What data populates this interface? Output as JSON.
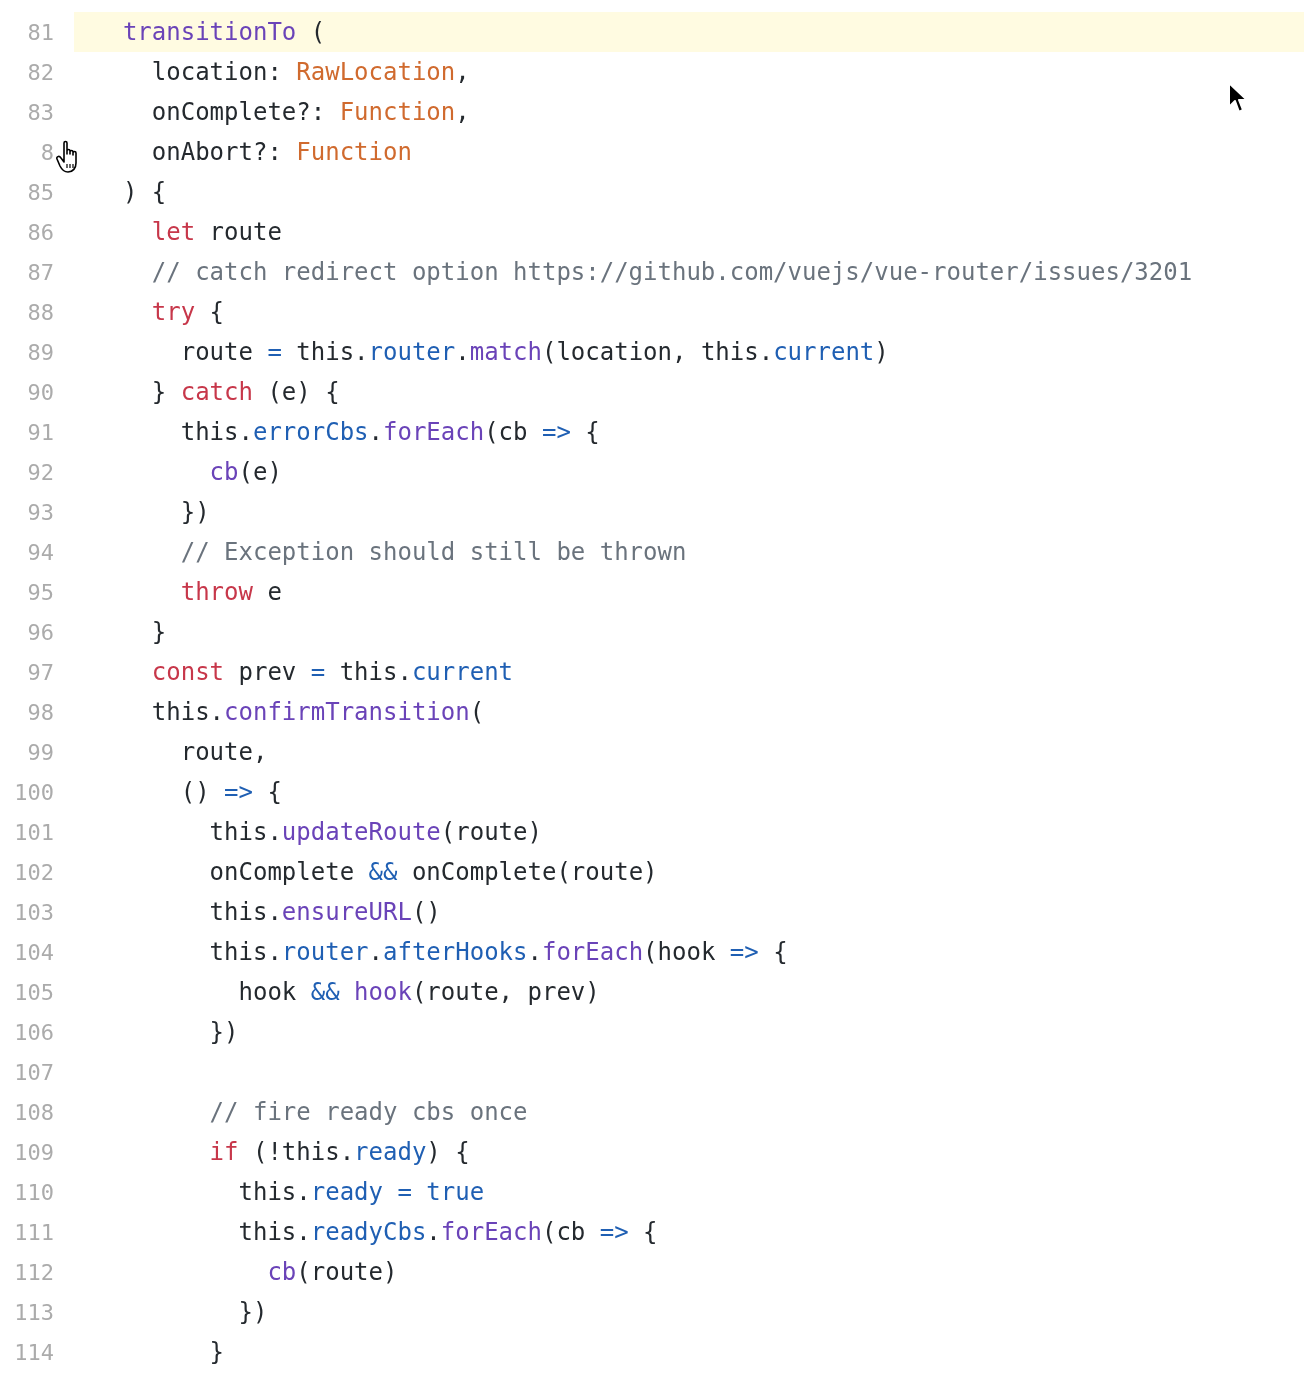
{
  "code_lines": [
    {
      "number": "81",
      "highlighted": true,
      "tokens": [
        {
          "kind": "func",
          "text": "  transitionTo"
        },
        {
          "kind": "plain",
          "text": " ("
        }
      ]
    },
    {
      "number": "82",
      "highlighted": false,
      "tokens": [
        {
          "kind": "plain",
          "text": "    location: "
        },
        {
          "kind": "type",
          "text": "RawLocation"
        },
        {
          "kind": "plain",
          "text": ","
        }
      ]
    },
    {
      "number": "83",
      "highlighted": false,
      "tokens": [
        {
          "kind": "plain",
          "text": "    onComplete?: "
        },
        {
          "kind": "type",
          "text": "Function"
        },
        {
          "kind": "plain",
          "text": ","
        }
      ]
    },
    {
      "number": "8",
      "highlighted": false,
      "tokens": [
        {
          "kind": "plain",
          "text": "    onAbort?: "
        },
        {
          "kind": "type",
          "text": "Function"
        }
      ]
    },
    {
      "number": "85",
      "highlighted": false,
      "tokens": [
        {
          "kind": "plain",
          "text": "  ) {"
        }
      ]
    },
    {
      "number": "86",
      "highlighted": false,
      "tokens": [
        {
          "kind": "keyword",
          "text": "    let"
        },
        {
          "kind": "plain",
          "text": " route"
        }
      ]
    },
    {
      "number": "87",
      "highlighted": false,
      "tokens": [
        {
          "kind": "comment",
          "text": "    // catch redirect option https://github.com/vuejs/vue-router/issues/3201"
        }
      ]
    },
    {
      "number": "88",
      "highlighted": false,
      "tokens": [
        {
          "kind": "keyword",
          "text": "    try"
        },
        {
          "kind": "plain",
          "text": " {"
        }
      ]
    },
    {
      "number": "89",
      "highlighted": false,
      "tokens": [
        {
          "kind": "plain",
          "text": "      route "
        },
        {
          "kind": "operator",
          "text": "="
        },
        {
          "kind": "plain",
          "text": " this."
        },
        {
          "kind": "property",
          "text": "router"
        },
        {
          "kind": "plain",
          "text": "."
        },
        {
          "kind": "func",
          "text": "match"
        },
        {
          "kind": "plain",
          "text": "(location, this."
        },
        {
          "kind": "property",
          "text": "current"
        },
        {
          "kind": "plain",
          "text": ")"
        }
      ]
    },
    {
      "number": "90",
      "highlighted": false,
      "tokens": [
        {
          "kind": "plain",
          "text": "    } "
        },
        {
          "kind": "keyword",
          "text": "catch"
        },
        {
          "kind": "plain",
          "text": " (e) {"
        }
      ]
    },
    {
      "number": "91",
      "highlighted": false,
      "tokens": [
        {
          "kind": "plain",
          "text": "      this."
        },
        {
          "kind": "property",
          "text": "errorCbs"
        },
        {
          "kind": "plain",
          "text": "."
        },
        {
          "kind": "func",
          "text": "forEach"
        },
        {
          "kind": "plain",
          "text": "(cb "
        },
        {
          "kind": "operator",
          "text": "=>"
        },
        {
          "kind": "plain",
          "text": " {"
        }
      ]
    },
    {
      "number": "92",
      "highlighted": false,
      "tokens": [
        {
          "kind": "func",
          "text": "        cb"
        },
        {
          "kind": "plain",
          "text": "(e)"
        }
      ]
    },
    {
      "number": "93",
      "highlighted": false,
      "tokens": [
        {
          "kind": "plain",
          "text": "      })"
        }
      ]
    },
    {
      "number": "94",
      "highlighted": false,
      "tokens": [
        {
          "kind": "comment",
          "text": "      // Exception should still be thrown"
        }
      ]
    },
    {
      "number": "95",
      "highlighted": false,
      "tokens": [
        {
          "kind": "keyword",
          "text": "      throw"
        },
        {
          "kind": "plain",
          "text": " e"
        }
      ]
    },
    {
      "number": "96",
      "highlighted": false,
      "tokens": [
        {
          "kind": "plain",
          "text": "    }"
        }
      ]
    },
    {
      "number": "97",
      "highlighted": false,
      "tokens": [
        {
          "kind": "keyword",
          "text": "    const"
        },
        {
          "kind": "plain",
          "text": " prev "
        },
        {
          "kind": "operator",
          "text": "="
        },
        {
          "kind": "plain",
          "text": " this."
        },
        {
          "kind": "property",
          "text": "current"
        }
      ]
    },
    {
      "number": "98",
      "highlighted": false,
      "tokens": [
        {
          "kind": "plain",
          "text": "    this."
        },
        {
          "kind": "func",
          "text": "confirmTransition"
        },
        {
          "kind": "plain",
          "text": "("
        }
      ]
    },
    {
      "number": "99",
      "highlighted": false,
      "tokens": [
        {
          "kind": "plain",
          "text": "      route,"
        }
      ]
    },
    {
      "number": "100",
      "highlighted": false,
      "tokens": [
        {
          "kind": "plain",
          "text": "      () "
        },
        {
          "kind": "operator",
          "text": "=>"
        },
        {
          "kind": "plain",
          "text": " {"
        }
      ]
    },
    {
      "number": "101",
      "highlighted": false,
      "tokens": [
        {
          "kind": "plain",
          "text": "        this."
        },
        {
          "kind": "func",
          "text": "updateRoute"
        },
        {
          "kind": "plain",
          "text": "(route)"
        }
      ]
    },
    {
      "number": "102",
      "highlighted": false,
      "tokens": [
        {
          "kind": "plain",
          "text": "        onComplete "
        },
        {
          "kind": "operator",
          "text": "&&"
        },
        {
          "kind": "plain",
          "text": " onComplete(route)"
        }
      ]
    },
    {
      "number": "103",
      "highlighted": false,
      "tokens": [
        {
          "kind": "plain",
          "text": "        this."
        },
        {
          "kind": "func",
          "text": "ensureURL"
        },
        {
          "kind": "plain",
          "text": "()"
        }
      ]
    },
    {
      "number": "104",
      "highlighted": false,
      "tokens": [
        {
          "kind": "plain",
          "text": "        this."
        },
        {
          "kind": "property",
          "text": "router"
        },
        {
          "kind": "plain",
          "text": "."
        },
        {
          "kind": "property",
          "text": "afterHooks"
        },
        {
          "kind": "plain",
          "text": "."
        },
        {
          "kind": "func",
          "text": "forEach"
        },
        {
          "kind": "plain",
          "text": "(hook "
        },
        {
          "kind": "operator",
          "text": "=>"
        },
        {
          "kind": "plain",
          "text": " {"
        }
      ]
    },
    {
      "number": "105",
      "highlighted": false,
      "tokens": [
        {
          "kind": "plain",
          "text": "          hook "
        },
        {
          "kind": "operator",
          "text": "&&"
        },
        {
          "kind": "func",
          "text": " hook"
        },
        {
          "kind": "plain",
          "text": "(route, prev)"
        }
      ]
    },
    {
      "number": "106",
      "highlighted": false,
      "tokens": [
        {
          "kind": "plain",
          "text": "        })"
        }
      ]
    },
    {
      "number": "107",
      "highlighted": false
    },
    {
      "number": "108",
      "highlighted": false,
      "tokens": [
        {
          "kind": "comment",
          "text": "        // fire ready cbs once"
        }
      ]
    },
    {
      "number": "109",
      "highlighted": false,
      "tokens": [
        {
          "kind": "keyword",
          "text": "        if"
        },
        {
          "kind": "plain",
          "text": " (!this."
        },
        {
          "kind": "property",
          "text": "ready"
        },
        {
          "kind": "plain",
          "text": ") {"
        }
      ]
    },
    {
      "number": "110",
      "highlighted": false,
      "tokens": [
        {
          "kind": "plain",
          "text": "          this."
        },
        {
          "kind": "property",
          "text": "ready"
        },
        {
          "kind": "operator",
          "text": " = true"
        }
      ]
    },
    {
      "number": "111",
      "highlighted": false,
      "tokens": [
        {
          "kind": "plain",
          "text": "          this."
        },
        {
          "kind": "property",
          "text": "readyCbs"
        },
        {
          "kind": "plain",
          "text": "."
        },
        {
          "kind": "func",
          "text": "forEach"
        },
        {
          "kind": "plain",
          "text": "(cb "
        },
        {
          "kind": "operator",
          "text": "=>"
        },
        {
          "kind": "plain",
          "text": " {"
        }
      ]
    },
    {
      "number": "112",
      "highlighted": false,
      "tokens": [
        {
          "kind": "func",
          "text": "            cb"
        },
        {
          "kind": "plain",
          "text": "(route)"
        }
      ]
    },
    {
      "number": "113",
      "highlighted": false,
      "tokens": [
        {
          "kind": "plain",
          "text": "          })"
        }
      ]
    },
    {
      "number": "114",
      "highlighted": false,
      "tokens": [
        {
          "kind": "plain",
          "text": "        }"
        }
      ]
    }
  ]
}
